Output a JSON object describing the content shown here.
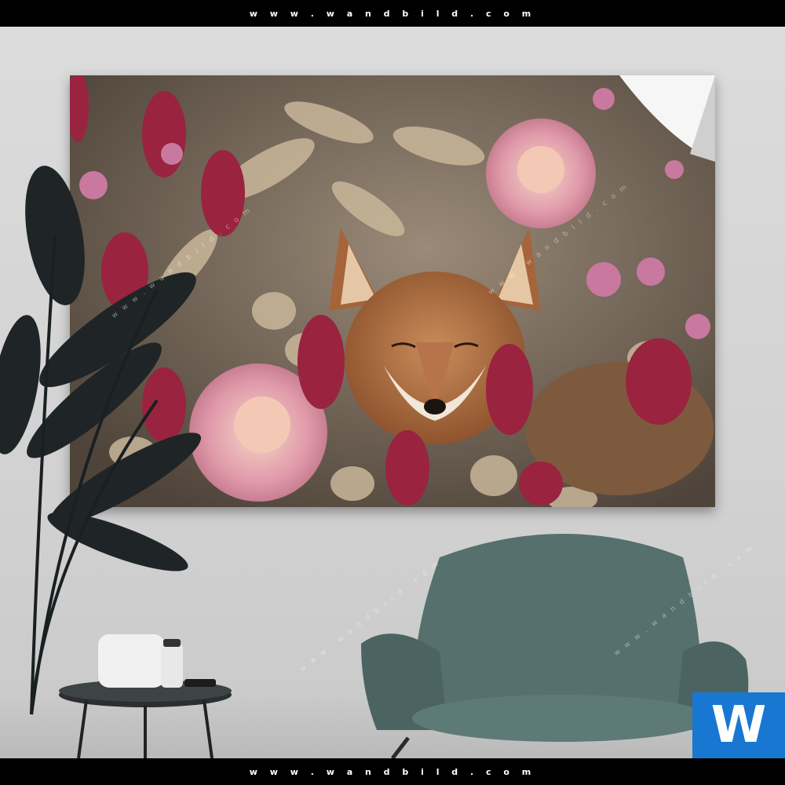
{
  "header": {
    "site_url": "w w w . w a n d b i l d . c o m"
  },
  "footer": {
    "site_url": "w w w . w a n d b i l d . c o m"
  },
  "logo": {
    "letter": "W",
    "color": "#1877d1"
  },
  "watermark": {
    "text": "w w w . w a n d b i l d . c o m"
  },
  "scene": {
    "artwork_subject": "fox-among-flowers",
    "colors": {
      "wall": "#d6d6d6",
      "chair": "#56706d",
      "plant": "#1f2527",
      "flower_pink": "#d98aa0",
      "flower_crimson": "#9a2340"
    }
  }
}
